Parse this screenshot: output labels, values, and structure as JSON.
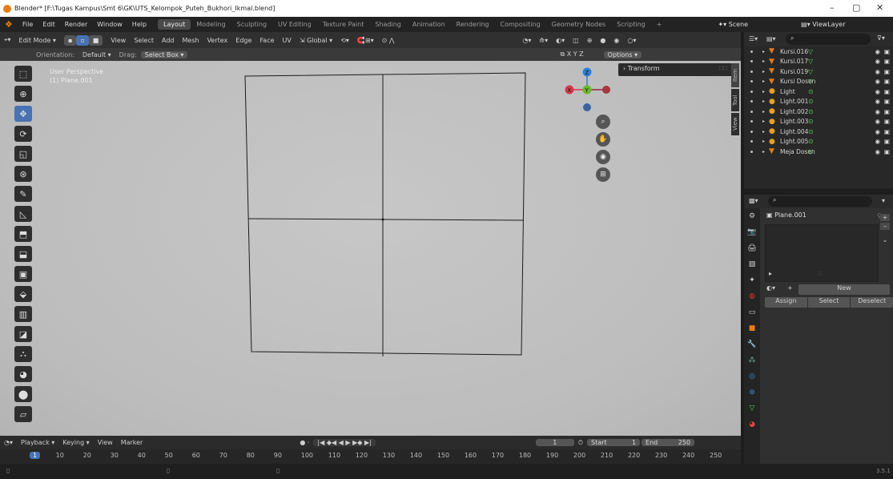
{
  "window": {
    "title": "Blender* [F:\\Tugas Kampus\\Smt 6\\GK\\UTS_Kelompok_Puteh_Bukhori_Ikmal.blend]",
    "minimize": "–",
    "maximize": "▢",
    "close": "✕"
  },
  "topbar": {
    "menus": [
      "File",
      "Edit",
      "Render",
      "Window",
      "Help"
    ],
    "workspaces": [
      "Layout",
      "Modeling",
      "Sculpting",
      "UV Editing",
      "Texture Paint",
      "Shading",
      "Animation",
      "Rendering",
      "Compositing",
      "Geometry Nodes",
      "Scripting"
    ],
    "active_workspace": "Layout",
    "add_workspace": "+",
    "scene": "Scene",
    "view_layer": "ViewLayer"
  },
  "viewport_header": {
    "mode": "Edit Mode",
    "menus": [
      "View",
      "Select",
      "Add",
      "Mesh",
      "Vertex",
      "Edge",
      "Face",
      "UV"
    ],
    "transform_orientation": "Global",
    "axes": [
      "X",
      "Y",
      "Z"
    ],
    "options": "Options"
  },
  "tool_settings": {
    "orientation_label": "Orientation:",
    "orientation_value": "Default",
    "drag_label": "Drag:",
    "drag_value": "Select Box"
  },
  "viewport": {
    "view_name": "User Perspective",
    "object_name": "(1) Plane.001",
    "transform_panel": "Transform",
    "side_tabs": [
      "Item",
      "Tool",
      "View"
    ],
    "gizmo_axes": [
      "X",
      "Y",
      "Z"
    ]
  },
  "tools": [
    "select-box",
    "cursor",
    "move",
    "rotate",
    "scale",
    "transform",
    "annotate",
    "measure",
    "add-cube",
    "extrude",
    "inset",
    "bevel",
    "loop-cut",
    "knife",
    "poly-build",
    "spin",
    "smooth",
    "shrink-fatten",
    "shear"
  ],
  "outliner": {
    "rows": [
      {
        "name": "Kursi.016",
        "icon": "triangle-icon"
      },
      {
        "name": "Kursi.017",
        "icon": "triangle-icon"
      },
      {
        "name": "Kursi.019",
        "icon": "triangle-icon"
      },
      {
        "name": "Kursi Dosen",
        "icon": "triangle-icon"
      },
      {
        "name": "Light",
        "icon": "light-icon"
      },
      {
        "name": "Light.001",
        "icon": "light-icon"
      },
      {
        "name": "Light.002",
        "icon": "light-icon"
      },
      {
        "name": "Light.003",
        "icon": "light-icon"
      },
      {
        "name": "Light.004",
        "icon": "light-icon"
      },
      {
        "name": "Light.005",
        "icon": "light-icon"
      },
      {
        "name": "Meja Dosen",
        "icon": "triangle-icon"
      }
    ]
  },
  "properties": {
    "object_name": "Plane.001",
    "new_label": "New",
    "assign_label": "Assign",
    "select_label": "Select",
    "deselect_label": "Deselect",
    "add": "+",
    "remove": "–"
  },
  "timeline": {
    "menus": [
      "Playback",
      "Keying",
      "View",
      "Marker"
    ],
    "current_frame": "1",
    "start_label": "Start",
    "start_value": "1",
    "end_label": "End",
    "end_value": "250",
    "ticks": [
      "1",
      "10",
      "20",
      "30",
      "40",
      "50",
      "60",
      "70",
      "80",
      "90",
      "100",
      "110",
      "120",
      "130",
      "140",
      "150",
      "160",
      "170",
      "180",
      "190",
      "200",
      "210",
      "220",
      "230",
      "240",
      "250"
    ]
  },
  "status": {
    "version": "3.5.1"
  },
  "colors": {
    "accent": "#4772b3",
    "mesh_orange": "#e87d0d",
    "active_ws": "#4a4a4a"
  }
}
